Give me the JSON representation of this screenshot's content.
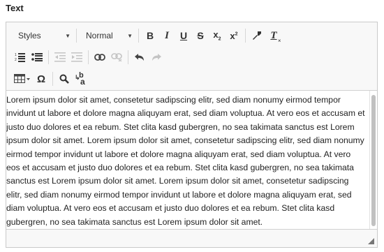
{
  "field": {
    "label": "Text"
  },
  "toolbar": {
    "styles_label": "Styles",
    "format_label": "Normal",
    "bold": "B",
    "italic": "I",
    "underline": "U",
    "strike": "S",
    "subscript_base": "x",
    "subscript_index": "2",
    "superscript_base": "x",
    "superscript_index": "2",
    "remove_format": "T",
    "special_char": "Ω",
    "replace_top": "b",
    "replace_bottom": "a",
    "icons": [
      "copy-format-icon",
      "remove-format-icon",
      "numbered-list-icon",
      "bulleted-list-icon",
      "decrease-indent-icon",
      "increase-indent-icon",
      "link-icon",
      "unlink-icon",
      "undo-icon",
      "redo-icon",
      "table-icon",
      "special-character-icon",
      "find-icon",
      "replace-icon"
    ]
  },
  "content": {
    "text": "Lorem ipsum dolor sit amet, consetetur sadipscing elitr, sed diam nonumy eirmod tempor invidunt ut labore et dolore magna aliquyam erat, sed diam voluptua. At vero eos et accusam et justo duo dolores et ea rebum. Stet clita kasd gubergren, no sea takimata sanctus est Lorem ipsum dolor sit amet. Lorem ipsum dolor sit amet, consetetur sadipscing elitr, sed diam nonumy eirmod tempor invidunt ut labore et dolore magna aliquyam erat, sed diam voluptua. At vero eos et accusam et justo duo dolores et ea rebum. Stet clita kasd gubergren, no sea takimata sanctus est Lorem ipsum dolor sit amet. Lorem ipsum dolor sit amet, consetetur sadipscing elitr, sed diam nonumy eirmod tempor invidunt ut labore et dolore magna aliquyam erat, sed diam voluptua. At vero eos et accusam et justo duo dolores et ea rebum. Stet clita kasd gubergren, no sea takimata sanctus est Lorem ipsum dolor sit amet."
  },
  "colors": {
    "accent": "#333333",
    "disabled": "#bdbdbd",
    "border": "#c9c9c9",
    "toolbar_bg": "#f8f8f8"
  }
}
